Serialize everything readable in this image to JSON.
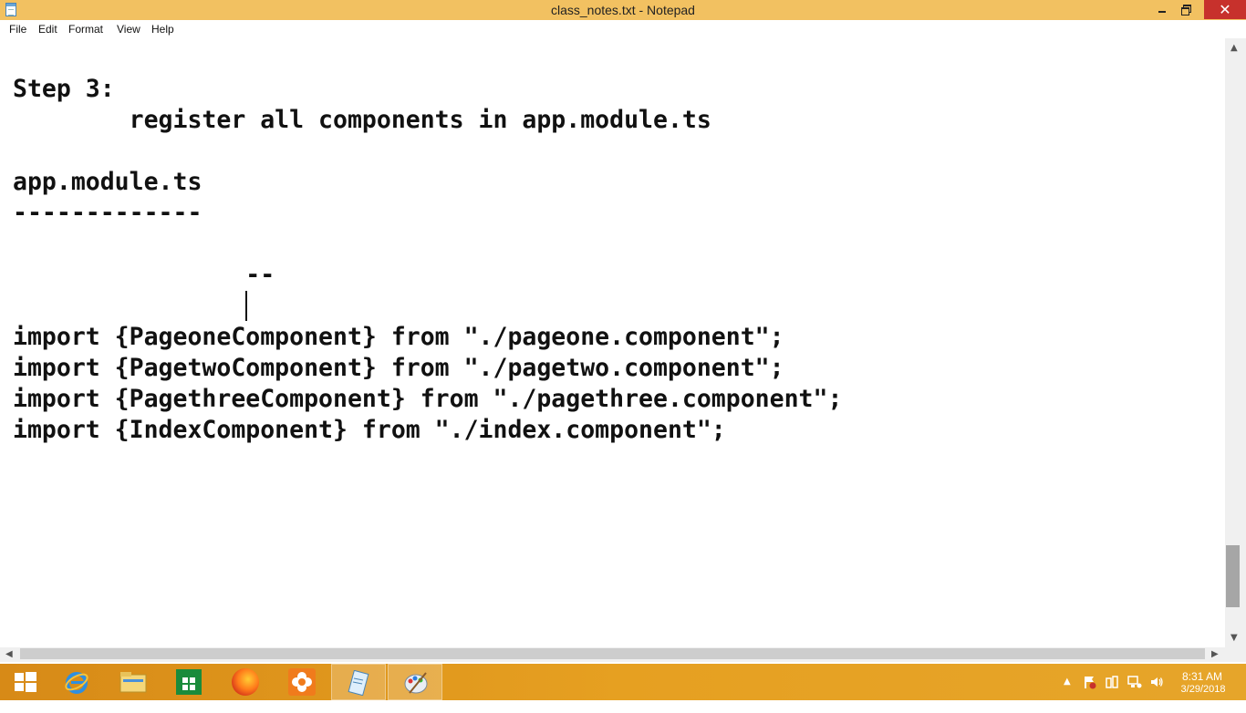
{
  "window": {
    "title": "class_notes.txt - Notepad",
    "close_glyph": "✕"
  },
  "menu": {
    "items": [
      "File",
      "Edit",
      "Format",
      "View",
      "Help"
    ]
  },
  "editor": {
    "lines": [
      "Step 3:",
      "        register all components in app.module.ts",
      "",
      "app.module.ts",
      "-------------",
      "",
      "                --",
      "",
      "import {PageoneComponent} from \"./pageone.component\";",
      "import {PagetwoComponent} from \"./pagetwo.component\";",
      "import {PagethreeComponent} from \"./pagethree.component\";",
      "import {IndexComponent} from \"./index.component\";"
    ]
  },
  "scrollbars": {
    "up_arrow": "▲",
    "down_arrow": "▼",
    "left_arrow": "◀",
    "right_arrow": "▶"
  },
  "taskbar": {
    "items": [
      {
        "icon": "windows-start-icon"
      },
      {
        "icon": "internet-explorer-icon"
      },
      {
        "icon": "file-explorer-icon"
      },
      {
        "icon": "windows-store-icon"
      },
      {
        "icon": "firefox-icon"
      },
      {
        "icon": "flower-app-icon"
      },
      {
        "icon": "notepad-icon",
        "active": true
      },
      {
        "icon": "paint-icon",
        "active": true
      }
    ],
    "tray_arrow": "▲",
    "clock_time": "8:31 AM",
    "clock_date": "3/29/2018"
  },
  "colors": {
    "title_bar": "#f2c161",
    "close_button": "#c7312c",
    "taskbar": "#e6a021"
  }
}
